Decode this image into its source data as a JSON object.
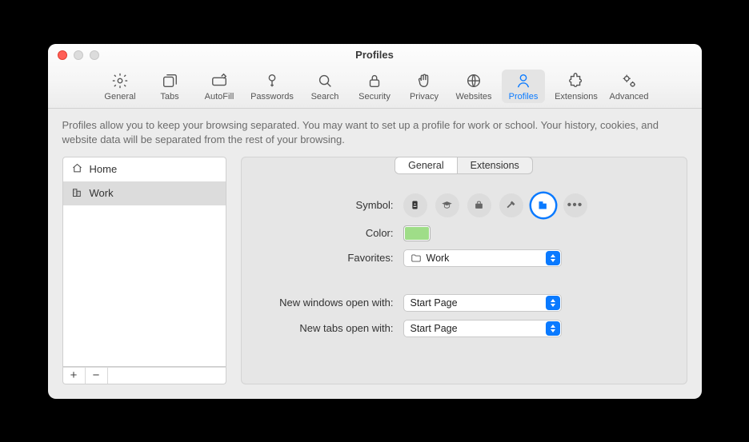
{
  "window": {
    "title": "Profiles"
  },
  "toolbar": {
    "items": [
      {
        "id": "general",
        "label": "General"
      },
      {
        "id": "tabs",
        "label": "Tabs"
      },
      {
        "id": "autofill",
        "label": "AutoFill"
      },
      {
        "id": "passwords",
        "label": "Passwords"
      },
      {
        "id": "search",
        "label": "Search"
      },
      {
        "id": "security",
        "label": "Security"
      },
      {
        "id": "privacy",
        "label": "Privacy"
      },
      {
        "id": "websites",
        "label": "Websites"
      },
      {
        "id": "profiles",
        "label": "Profiles"
      },
      {
        "id": "extensions",
        "label": "Extensions"
      },
      {
        "id": "advanced",
        "label": "Advanced"
      }
    ],
    "selected": "profiles"
  },
  "description": "Profiles allow you to keep your browsing separated. You may want to set up a profile for work or school. Your history, cookies, and website data will be separated from the rest of your browsing.",
  "sidebar": {
    "items": [
      {
        "icon": "house",
        "label": "Home"
      },
      {
        "icon": "buildings",
        "label": "Work"
      }
    ],
    "selected": 1,
    "add_label": "+",
    "remove_label": "−"
  },
  "tabs": {
    "items": [
      "General",
      "Extensions"
    ],
    "selected": 0
  },
  "form": {
    "symbol_label": "Symbol:",
    "color_label": "Color:",
    "favorites_label": "Favorites:",
    "new_windows_label": "New windows open with:",
    "new_tabs_label": "New tabs open with:",
    "favorites_value": "Work",
    "new_windows_value": "Start Page",
    "new_tabs_value": "Start Page",
    "color_value": "#9fdd88",
    "symbols": [
      "id-badge",
      "graduation-cap",
      "briefcase",
      "hammer",
      "buildings",
      "more"
    ],
    "symbol_selected": 4
  }
}
